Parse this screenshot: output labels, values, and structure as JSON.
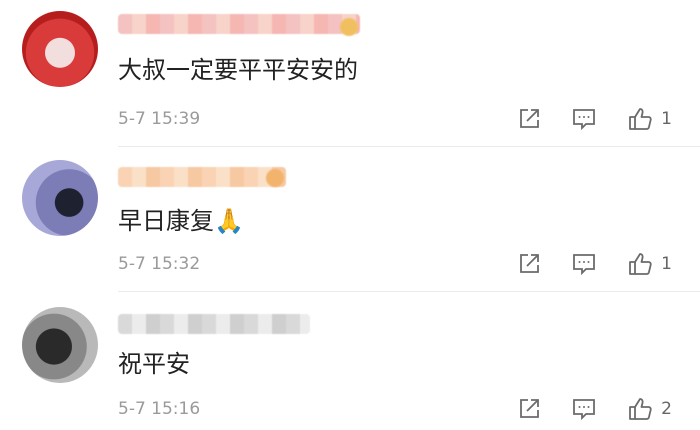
{
  "comments": [
    {
      "text": "大叔一定要平平安安的",
      "time": "5-7 15:39",
      "likes": "1",
      "avatar_icon": "red-pixelated-avatar-icon",
      "username_color": "#f4c2c0",
      "badge_icon": "gold-badge-icon"
    },
    {
      "text": "早日康复🙏",
      "time": "5-7 15:32",
      "likes": "1",
      "avatar_icon": "purple-pixelated-avatar-icon",
      "username_color": "#f9d3b3",
      "badge_icon": "orange-badge-icon"
    },
    {
      "text": "祝平安",
      "time": "5-7 15:16",
      "likes": "2",
      "avatar_icon": "gray-pixelated-avatar-icon",
      "username_color": "#d9d9d9"
    }
  ],
  "icons": {
    "share": "share-icon",
    "reply": "comment-icon",
    "like": "thumbs-up-icon"
  }
}
